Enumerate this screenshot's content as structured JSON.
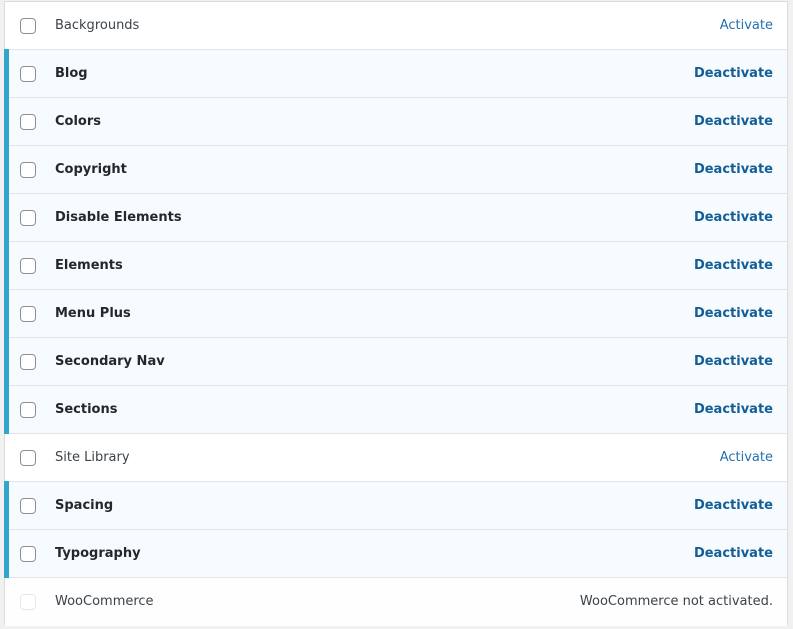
{
  "modules": [
    {
      "name": "Backgrounds",
      "status": "inactive",
      "action": "Activate"
    },
    {
      "name": "Blog",
      "status": "active",
      "action": "Deactivate"
    },
    {
      "name": "Colors",
      "status": "active",
      "action": "Deactivate"
    },
    {
      "name": "Copyright",
      "status": "active",
      "action": "Deactivate"
    },
    {
      "name": "Disable Elements",
      "status": "active",
      "action": "Deactivate"
    },
    {
      "name": "Elements",
      "status": "active",
      "action": "Deactivate"
    },
    {
      "name": "Menu Plus",
      "status": "active",
      "action": "Deactivate"
    },
    {
      "name": "Secondary Nav",
      "status": "active",
      "action": "Deactivate"
    },
    {
      "name": "Sections",
      "status": "active",
      "action": "Deactivate"
    },
    {
      "name": "Site Library",
      "status": "inactive",
      "action": "Activate"
    },
    {
      "name": "Spacing",
      "status": "active",
      "action": "Deactivate"
    },
    {
      "name": "Typography",
      "status": "active",
      "action": "Deactivate"
    },
    {
      "name": "WooCommerce",
      "status": "disabled",
      "note": "WooCommerce not activated."
    }
  ],
  "colors": {
    "active_border": "#33a4cc",
    "active_bg": "#f6fbff",
    "link": "#135e96"
  }
}
